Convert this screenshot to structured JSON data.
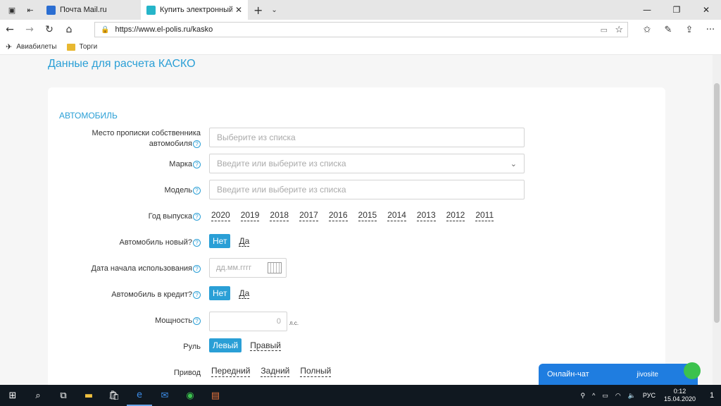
{
  "browser": {
    "tabs": [
      {
        "label": "Почта Mail.ru",
        "favicon_color": "#2b6ed2"
      },
      {
        "label": "Купить электронный п",
        "favicon_color": "#26b5c9"
      }
    ],
    "url": "https://www.el-polis.ru/kasko",
    "favorites": [
      "Авиабилеты",
      "Торги"
    ]
  },
  "page": {
    "title": "Данные для расчета КАСКО",
    "section": "АВТОМОБИЛЬ",
    "registration": {
      "label_line1": "Место прописки собственника",
      "label_line2": "автомобиля",
      "placeholder": "Выберите из списка"
    },
    "brand": {
      "label": "Марка",
      "placeholder": "Введите или выберите из списка"
    },
    "model": {
      "label": "Модель",
      "placeholder": "Введите или выберите из списка"
    },
    "year": {
      "label": "Год выпуска",
      "options": [
        "2020",
        "2019",
        "2018",
        "2017",
        "2016",
        "2015",
        "2014",
        "2013",
        "2012",
        "2011"
      ]
    },
    "is_new": {
      "label": "Автомобиль новый?",
      "on": "Нет",
      "off": "Да"
    },
    "start_date": {
      "label": "Дата начала использования",
      "placeholder": "дд.мм.гггг"
    },
    "credit": {
      "label": "Автомобиль в кредит?",
      "on": "Нет",
      "off": "Да"
    },
    "power": {
      "label": "Мощность",
      "value": "0",
      "unit": "л.с."
    },
    "wheel": {
      "label": "Руль",
      "on": "Левый",
      "off": "Правый"
    },
    "drive": {
      "label": "Привод",
      "options": [
        "Передний",
        "Задний",
        "Полный"
      ]
    },
    "help_glyph": "?"
  },
  "chat": {
    "label": "Онлайн-чат",
    "brand": "jivosite",
    "accent": "#1f7de0"
  },
  "taskbar": {
    "lang": "РУС",
    "time": "0:12",
    "date": "15.04.2020",
    "notifications": "1"
  },
  "colors": {
    "accent": "#2a9fd6"
  }
}
